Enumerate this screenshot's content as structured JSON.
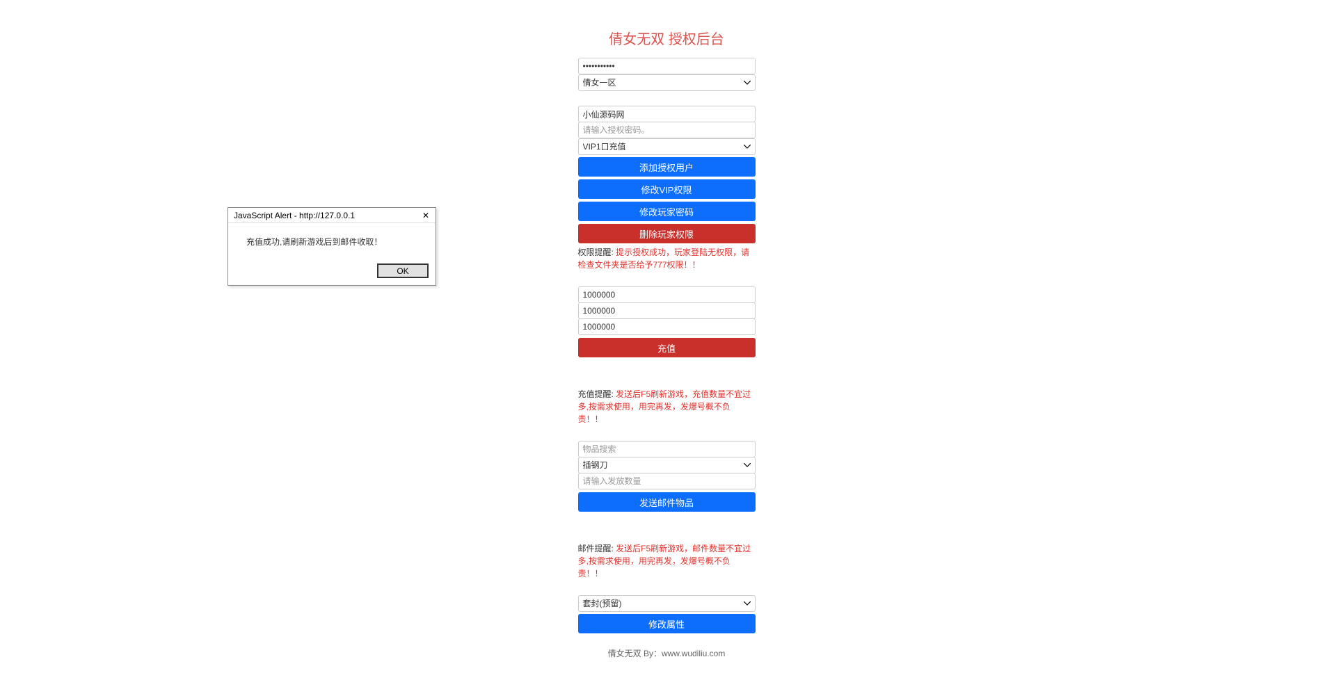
{
  "title": "倩女无双 授权后台",
  "top": {
    "password_value": "•••••••••••",
    "area_selected": "倩女一区"
  },
  "auth": {
    "username_value": "小仙源码网",
    "password_placeholder": "请输入授权密码。",
    "vip_selected": "VIP1口充值",
    "btn_add": "添加授权用户",
    "btn_vip": "修改VIP权限",
    "btn_pw": "修改玩家密码",
    "btn_del": "删除玩家权限",
    "note_label": "权限提醒: ",
    "note_red": "提示授权成功，玩家登陆无权限，请检查文件夹是否给予777权限！！"
  },
  "recharge": {
    "v1": "1000000",
    "v2": "1000000",
    "v3": "1000000",
    "btn": "充值",
    "note_label": "充值提醒: ",
    "note_red": "发送后F5刷新游戏，充值数量不宜过多,按需求使用，用完再发，发爆号概不负责！！"
  },
  "mail": {
    "search_placeholder": "物品搜索",
    "item_selected": "插钢刀",
    "qty_placeholder": "请输入发放数量",
    "btn": "发送邮件物品",
    "note_label": "邮件提醒: ",
    "note_red": "发送后F5刷新游戏，邮件数量不宜过多,按需求使用，用完再发，发爆号概不负责！！"
  },
  "attr": {
    "select_value": "套封(预留)",
    "btn": "修改属性"
  },
  "footer": "倩女无双 By：www.wudiliu.com",
  "alert": {
    "title": "JavaScript Alert - http://127.0.0.1",
    "message": "充值成功,请刷新游戏后到邮件收取！",
    "ok": "OK"
  }
}
